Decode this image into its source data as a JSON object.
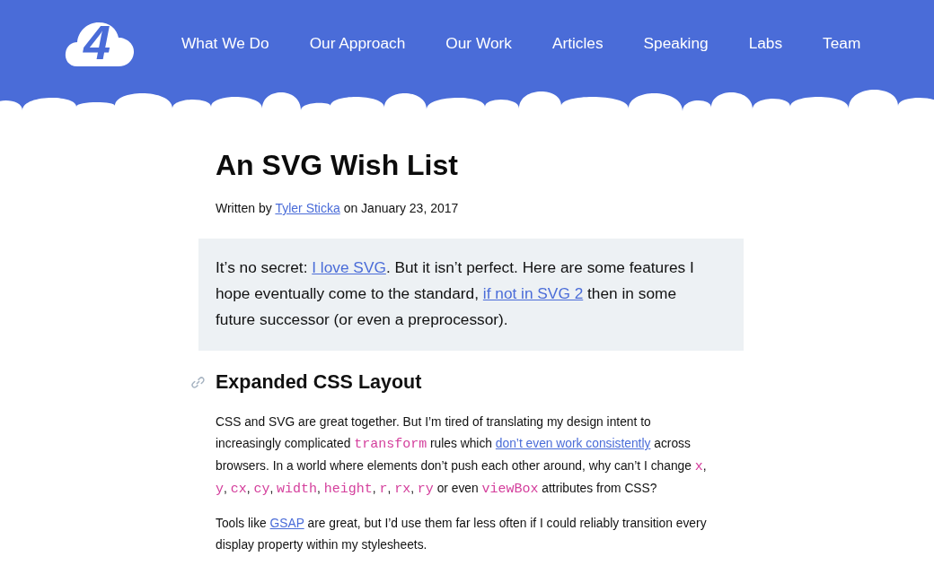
{
  "header": {
    "logo": {
      "mark": "4"
    },
    "nav": [
      {
        "label": "What We Do"
      },
      {
        "label": "Our Approach"
      },
      {
        "label": "Our Work"
      },
      {
        "label": "Articles"
      },
      {
        "label": "Speaking"
      },
      {
        "label": "Labs"
      },
      {
        "label": "Team"
      }
    ]
  },
  "article": {
    "title": "An SVG Wish List",
    "byline": [
      {
        "kind": "text",
        "text": "Written by "
      },
      {
        "kind": "link",
        "text": "Tyler Sticka"
      },
      {
        "kind": "text",
        "text": " on January 23, 2017"
      }
    ],
    "intro": [
      {
        "kind": "text",
        "text": "It’s no secret: "
      },
      {
        "kind": "link",
        "text": "I love SVG"
      },
      {
        "kind": "text",
        "text": ". But it isn’t perfect. Here are some features I hope eventually come to the standard, "
      },
      {
        "kind": "link",
        "text": "if not in SVG 2"
      },
      {
        "kind": "text",
        "text": " then in some future successor (or even a preprocessor)."
      }
    ],
    "sections": [
      {
        "heading": "Expanded CSS Layout",
        "paragraphs": [
          [
            {
              "kind": "text",
              "text": "CSS and SVG are great together. But I’m tired of translating my design intent to increasingly complicated "
            },
            {
              "kind": "code",
              "text": "transform"
            },
            {
              "kind": "text",
              "text": " rules which "
            },
            {
              "kind": "link",
              "text": "don’t even work consistently"
            },
            {
              "kind": "text",
              "text": " across browsers. In a world where elements don’t push each other around, why can’t I change "
            },
            {
              "kind": "code",
              "text": "x"
            },
            {
              "kind": "text",
              "text": ", "
            },
            {
              "kind": "code",
              "text": "y"
            },
            {
              "kind": "text",
              "text": ", "
            },
            {
              "kind": "code",
              "text": "cx"
            },
            {
              "kind": "text",
              "text": ", "
            },
            {
              "kind": "code",
              "text": "cy"
            },
            {
              "kind": "text",
              "text": ", "
            },
            {
              "kind": "code",
              "text": "width"
            },
            {
              "kind": "text",
              "text": ", "
            },
            {
              "kind": "code",
              "text": "height"
            },
            {
              "kind": "text",
              "text": ", "
            },
            {
              "kind": "code",
              "text": "r"
            },
            {
              "kind": "text",
              "text": ", "
            },
            {
              "kind": "code",
              "text": "rx"
            },
            {
              "kind": "text",
              "text": ", "
            },
            {
              "kind": "code",
              "text": "ry"
            },
            {
              "kind": "text",
              "text": " or even "
            },
            {
              "kind": "code",
              "text": "viewBox"
            },
            {
              "kind": "text",
              "text": " attributes from CSS?"
            }
          ],
          [
            {
              "kind": "text",
              "text": "Tools like "
            },
            {
              "kind": "link",
              "text": "GSAP"
            },
            {
              "kind": "text",
              "text": " are great, but I’d use them far less often if I could reliably transition every display property within my stylesheets."
            }
          ]
        ]
      }
    ]
  }
}
